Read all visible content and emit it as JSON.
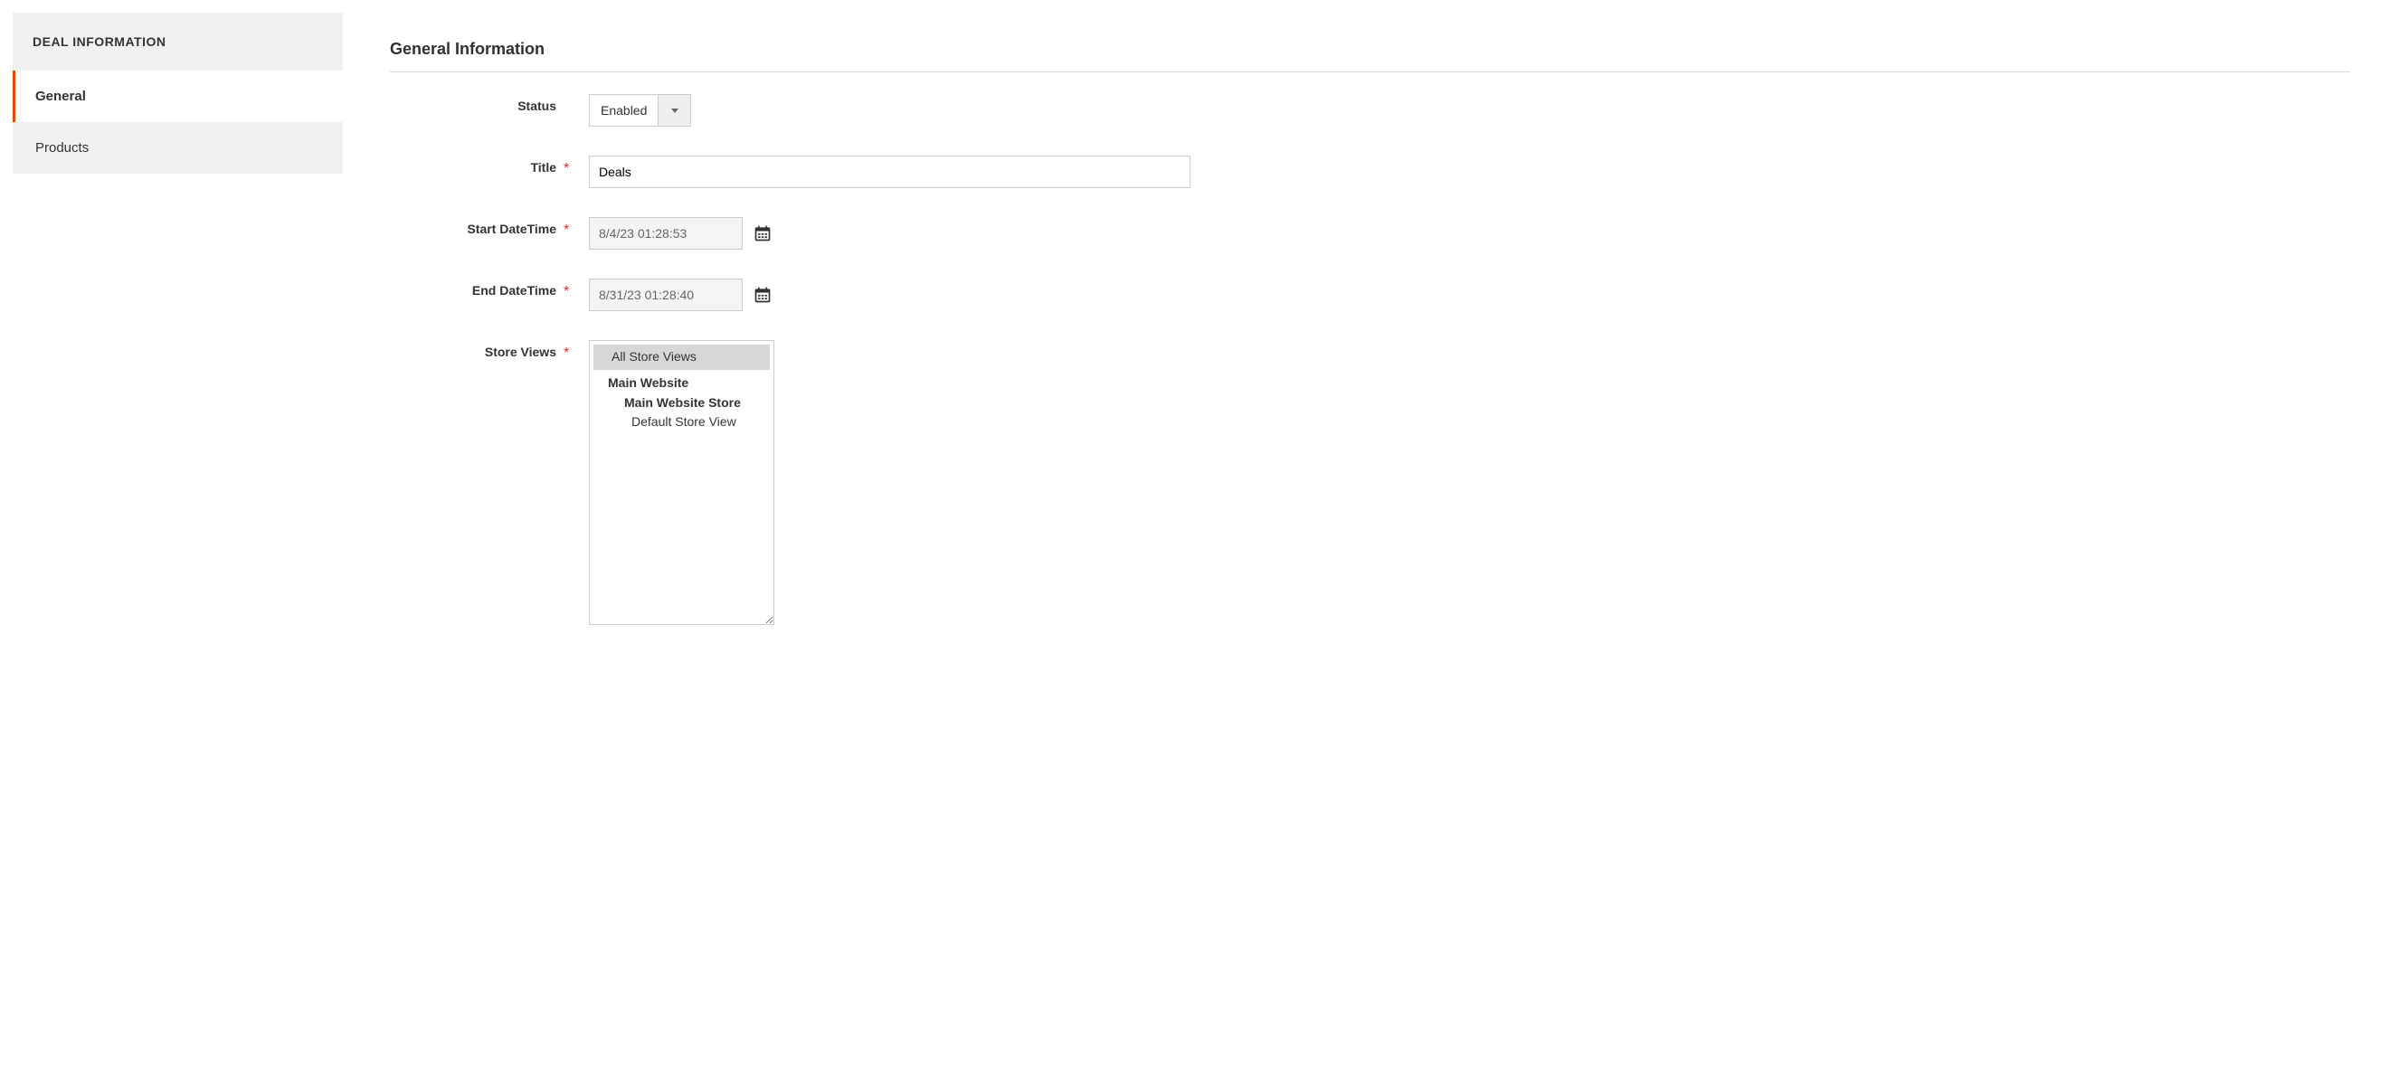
{
  "sidebar": {
    "header": "DEAL INFORMATION",
    "items": [
      {
        "label": "General",
        "active": true
      },
      {
        "label": "Products",
        "active": false
      }
    ]
  },
  "section": {
    "title": "General Information"
  },
  "form": {
    "status": {
      "label": "Status",
      "value": "Enabled"
    },
    "title": {
      "label": "Title",
      "value": "Deals"
    },
    "start": {
      "label": "Start DateTime",
      "value": "8/4/23 01:28:53"
    },
    "end": {
      "label": "End DateTime",
      "value": "8/31/23 01:28:40"
    },
    "store": {
      "label": "Store Views",
      "options": {
        "all": "All Store Views",
        "website": "Main Website",
        "store": "Main Website Store",
        "view": "Default Store View"
      }
    }
  }
}
